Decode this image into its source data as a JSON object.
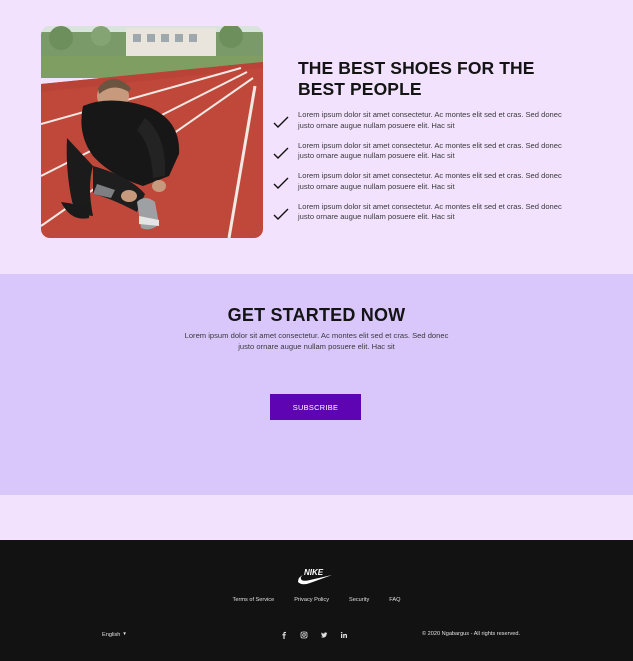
{
  "hero": {
    "image_alt": "Runner tying his shoe on a red running track",
    "title": "THE BEST SHOES FOR THE BEST PEOPLE",
    "features": [
      {
        "icon": "check-icon",
        "text": "Lorem ipsum dolor sit amet consectetur. Ac montes elit sed et cras. Sed donec justo ornare augue nullam posuere elit. Hac sit"
      },
      {
        "icon": "check-icon",
        "text": "Lorem ipsum dolor sit amet consectetur. Ac montes elit sed et cras. Sed donec justo ornare augue nullam posuere elit. Hac sit"
      },
      {
        "icon": "check-icon",
        "text": "Lorem ipsum dolor sit amet consectetur. Ac montes elit sed et cras. Sed donec justo ornare augue nullam posuere elit. Hac sit"
      },
      {
        "icon": "check-icon",
        "text": "Lorem ipsum dolor sit amet consectetur. Ac montes elit sed et cras. Sed donec justo ornare augue nullam posuere elit. Hac sit"
      }
    ]
  },
  "cta": {
    "title": "GET STARTED NOW",
    "text": "Lorem ipsum dolor sit amet consectetur. Ac montes elit sed et cras. Sed donec justo ornare augue nullam posuere elit. Hac sit",
    "button_label": "SUBSCRIBE"
  },
  "footer": {
    "logo_text": "NIKE",
    "links": [
      "Terms of Service",
      "Privacy Policy",
      "Security",
      "FAQ"
    ],
    "language": "English",
    "social_icons": [
      "facebook-icon",
      "instagram-icon",
      "twitter-icon",
      "linkedin-icon"
    ],
    "copyright": "© 2020 Ngabargus - All rights reserved."
  },
  "colors": {
    "page_bg": "#f2e2fd",
    "cta_bg": "#d9c7fc",
    "button_bg": "#5e04b3",
    "footer_bg": "#121212"
  }
}
